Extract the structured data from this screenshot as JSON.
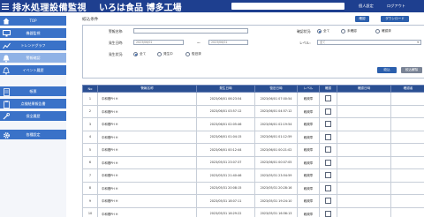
{
  "header": {
    "app_title": "排水処理設備監視",
    "factory": "いろは食品 博多工場",
    "links": [
      "個人設定",
      "ログアウト"
    ]
  },
  "sidebar": {
    "items": [
      {
        "label": "TOP",
        "icon": "home-icon"
      },
      {
        "label": "機器監視",
        "icon": "monitor-icon"
      },
      {
        "label": "トレンドグラフ",
        "icon": "chart-icon"
      },
      {
        "label": "警報確認",
        "icon": "bell-icon",
        "active": true
      },
      {
        "label": "イベント履歴",
        "icon": "bell-outline-icon"
      },
      {
        "label": "帳票",
        "icon": "report-icon"
      },
      {
        "label": "点検結果報告書",
        "icon": "clipboard-icon"
      },
      {
        "label": "保全履歴",
        "icon": "tools-icon"
      },
      {
        "label": "各種設定",
        "icon": "gear-icon"
      }
    ]
  },
  "main": {
    "section_title": "絞込条件",
    "confirm_label": "確認",
    "download_label": "ダウンロード",
    "filters": {
      "name_label": "警報名称:",
      "date_label": "発生日時:",
      "date_from": "2023/06/01",
      "date_to": "2023/06/01",
      "date_sep": "〜",
      "status_label": "発生状況:",
      "status_options": [
        "全て",
        "発生中",
        "復旧済"
      ],
      "confirm_status_label": "確認状況:",
      "confirm_options": [
        "全て",
        "未確認",
        "確認済"
      ],
      "level_label": "レベル:",
      "level_value": "全て",
      "search_button": "絞込",
      "clear_button": "絞込解除"
    }
  },
  "table": {
    "columns": [
      "No",
      "警報名称",
      "発生日時",
      "復旧日時",
      "レベル",
      "確認",
      "確認日時",
      "確認者"
    ],
    "rows": [
      {
        "no": "1",
        "name": "中和槽PH H",
        "occurred": "2023/06/01 06:23:54",
        "recovered": "2023/06/01 07:00:54",
        "level": "軽故障"
      },
      {
        "no": "2",
        "name": "中和槽PH H",
        "occurred": "2023/06/01 03:57:12",
        "recovered": "2023/06/01 04:57:12",
        "level": "軽故障"
      },
      {
        "no": "3",
        "name": "中和槽PH H",
        "occurred": "2023/06/01 02:05:46",
        "recovered": "2023/06/01 02:19:54",
        "level": "軽故障"
      },
      {
        "no": "4",
        "name": "中和槽PH H",
        "occurred": "2023/06/01 01:04:15",
        "recovered": "2023/06/01 01:12:59",
        "level": "軽故障"
      },
      {
        "no": "5",
        "name": "中和槽PH H",
        "occurred": "2023/06/01 00:12:44",
        "recovered": "2023/06/01 00:21:02",
        "level": "軽故障"
      },
      {
        "no": "6",
        "name": "中和槽PH H",
        "occurred": "2023/05/31 23:07:37",
        "recovered": "2023/06/01 00:07:05",
        "level": "軽故障"
      },
      {
        "no": "7",
        "name": "中和槽PH H",
        "occurred": "2023/05/31 21:40:46",
        "recovered": "2023/05/31 23:54:59",
        "level": "軽故障"
      },
      {
        "no": "8",
        "name": "中和槽PH H",
        "occurred": "2023/05/31 20:08:15",
        "recovered": "2023/05/31 20:28:16",
        "level": "軽故障"
      },
      {
        "no": "9",
        "name": "中和槽PH H",
        "occurred": "2023/05/31 18:07:11",
        "recovered": "2023/05/31 19:24:10",
        "level": "軽故障"
      },
      {
        "no": "10",
        "name": "中和槽PH H",
        "occurred": "2023/05/31 16:29:22",
        "recovered": "2023/05/31 16:56:13",
        "level": "軽故障"
      }
    ]
  },
  "colors": {
    "header": "#1e3f8f",
    "nav": "#3a72c8",
    "nav_active": "#8fb2e6",
    "table_header": "#2a4f92",
    "button": "#2b5fad"
  }
}
